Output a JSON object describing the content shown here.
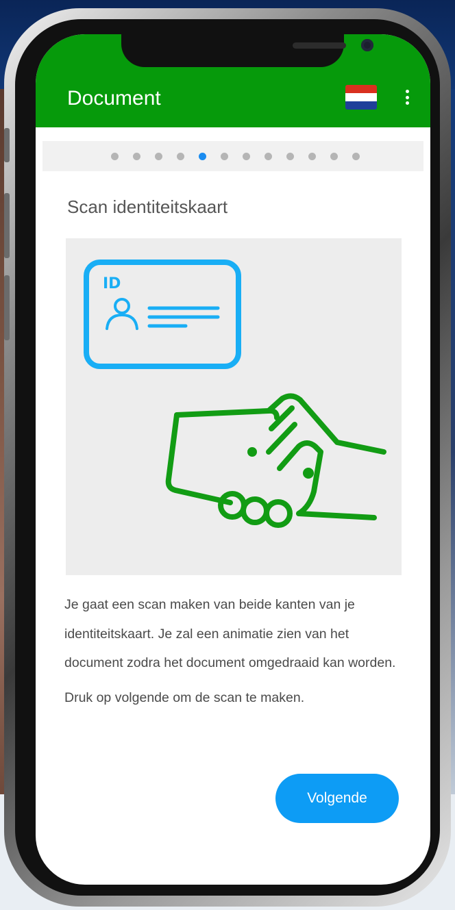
{
  "app": {
    "title": "Document",
    "accent_color": "#069a0b",
    "language_flag": "netherlands-flag",
    "menu_icon": "more-vert-icon"
  },
  "stepper": {
    "total_steps": 12,
    "current_step": 5,
    "active_color": "#1a8cf0"
  },
  "content": {
    "title": "Scan identiteitskaart",
    "illustration": {
      "id_card_label": "ID",
      "id_card_color": "#19aef5",
      "hand_color": "#129c14"
    },
    "paragraphs": [
      "Je gaat een scan maken van beide kanten van je identiteitskaart. Je zal een animatie zien van het document zodra het document omgedraaid kan worden.",
      "Druk op volgende om de scan te maken."
    ]
  },
  "actions": {
    "next_label": "Volgende",
    "next_color": "#0d9cf5"
  }
}
